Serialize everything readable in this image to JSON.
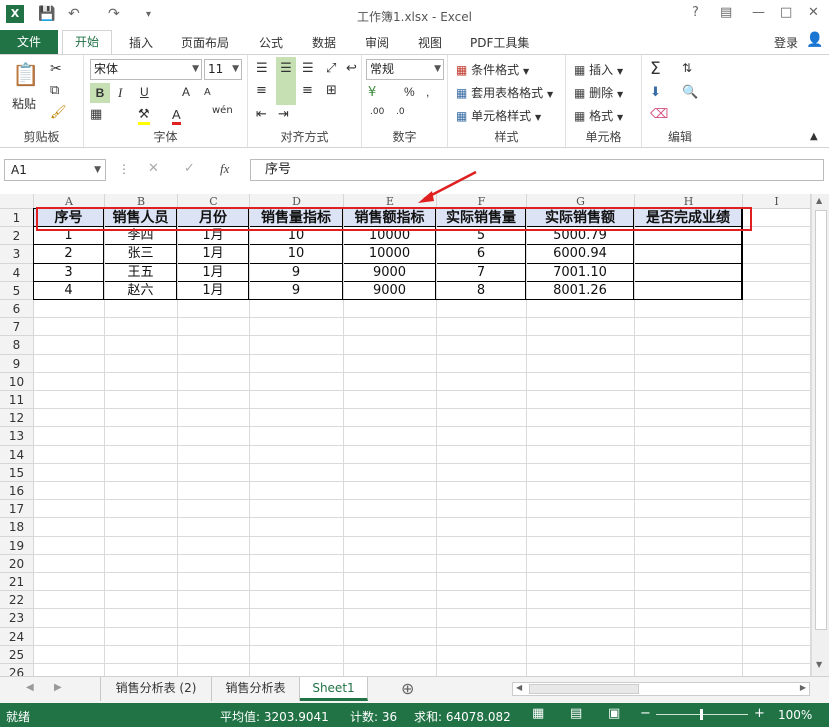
{
  "window": {
    "title": "工作簿1.xlsx - Excel",
    "help": "?",
    "login": "登录"
  },
  "ribbon_tabs": [
    "文件",
    "开始",
    "插入",
    "页面布局",
    "公式",
    "数据",
    "审阅",
    "视图",
    "PDF工具集"
  ],
  "ribbon": {
    "clipboard": {
      "label": "剪贴板",
      "paste": "粘贴"
    },
    "font": {
      "label": "字体",
      "name": "宋体",
      "size": "11",
      "bold": "B",
      "italic": "I",
      "underline": "U",
      "grow": "A",
      "shrink": "A",
      "wen": "wén"
    },
    "align": {
      "label": "对齐方式"
    },
    "number": {
      "label": "数字",
      "format": "常规",
      "percent": "%",
      "comma": ","
    },
    "styles": {
      "label": "样式",
      "cond": "条件格式",
      "table": "套用表格格式",
      "cell": "单元格样式"
    },
    "cells": {
      "label": "单元格",
      "insert": "插入",
      "delete": "删除",
      "format": "格式"
    },
    "edit": {
      "label": "编辑"
    }
  },
  "formula": {
    "namebox": "A1",
    "fx": "fx",
    "content": "序号"
  },
  "columns": [
    "A",
    "B",
    "C",
    "D",
    "E",
    "F",
    "G",
    "H",
    "I"
  ],
  "rows": [
    "1",
    "2",
    "3",
    "4",
    "5",
    "6",
    "7",
    "8",
    "9",
    "10",
    "11",
    "12",
    "13",
    "14",
    "15",
    "16",
    "17",
    "18",
    "19",
    "20",
    "21",
    "22",
    "23",
    "24",
    "25",
    "26"
  ],
  "table": {
    "header": [
      "序号",
      "销售人员",
      "月份",
      "销售量指标",
      "销售额指标",
      "实际销售量",
      "实际销售额",
      "是否完成业绩"
    ],
    "rows": [
      [
        "1",
        "李四",
        "1月",
        "10",
        "10000",
        "5",
        "5000.79",
        ""
      ],
      [
        "2",
        "张三",
        "1月",
        "10",
        "10000",
        "6",
        "6000.94",
        ""
      ],
      [
        "3",
        "王五",
        "1月",
        "9",
        "9000",
        "7",
        "7001.10",
        ""
      ],
      [
        "4",
        "赵六",
        "1月",
        "9",
        "9000",
        "8",
        "8001.26",
        ""
      ]
    ]
  },
  "sheets": [
    "销售分析表 (2)",
    "销售分析表",
    "Sheet1"
  ],
  "active_sheet": "Sheet1",
  "status": {
    "ready": "就绪",
    "avg": "平均值: 3203.9041",
    "count": "计数: 36",
    "sum": "求和: 64078.082",
    "zoom": "100%"
  },
  "colors": {
    "excel_green": "#217346",
    "highlight_red": "#e02020"
  }
}
